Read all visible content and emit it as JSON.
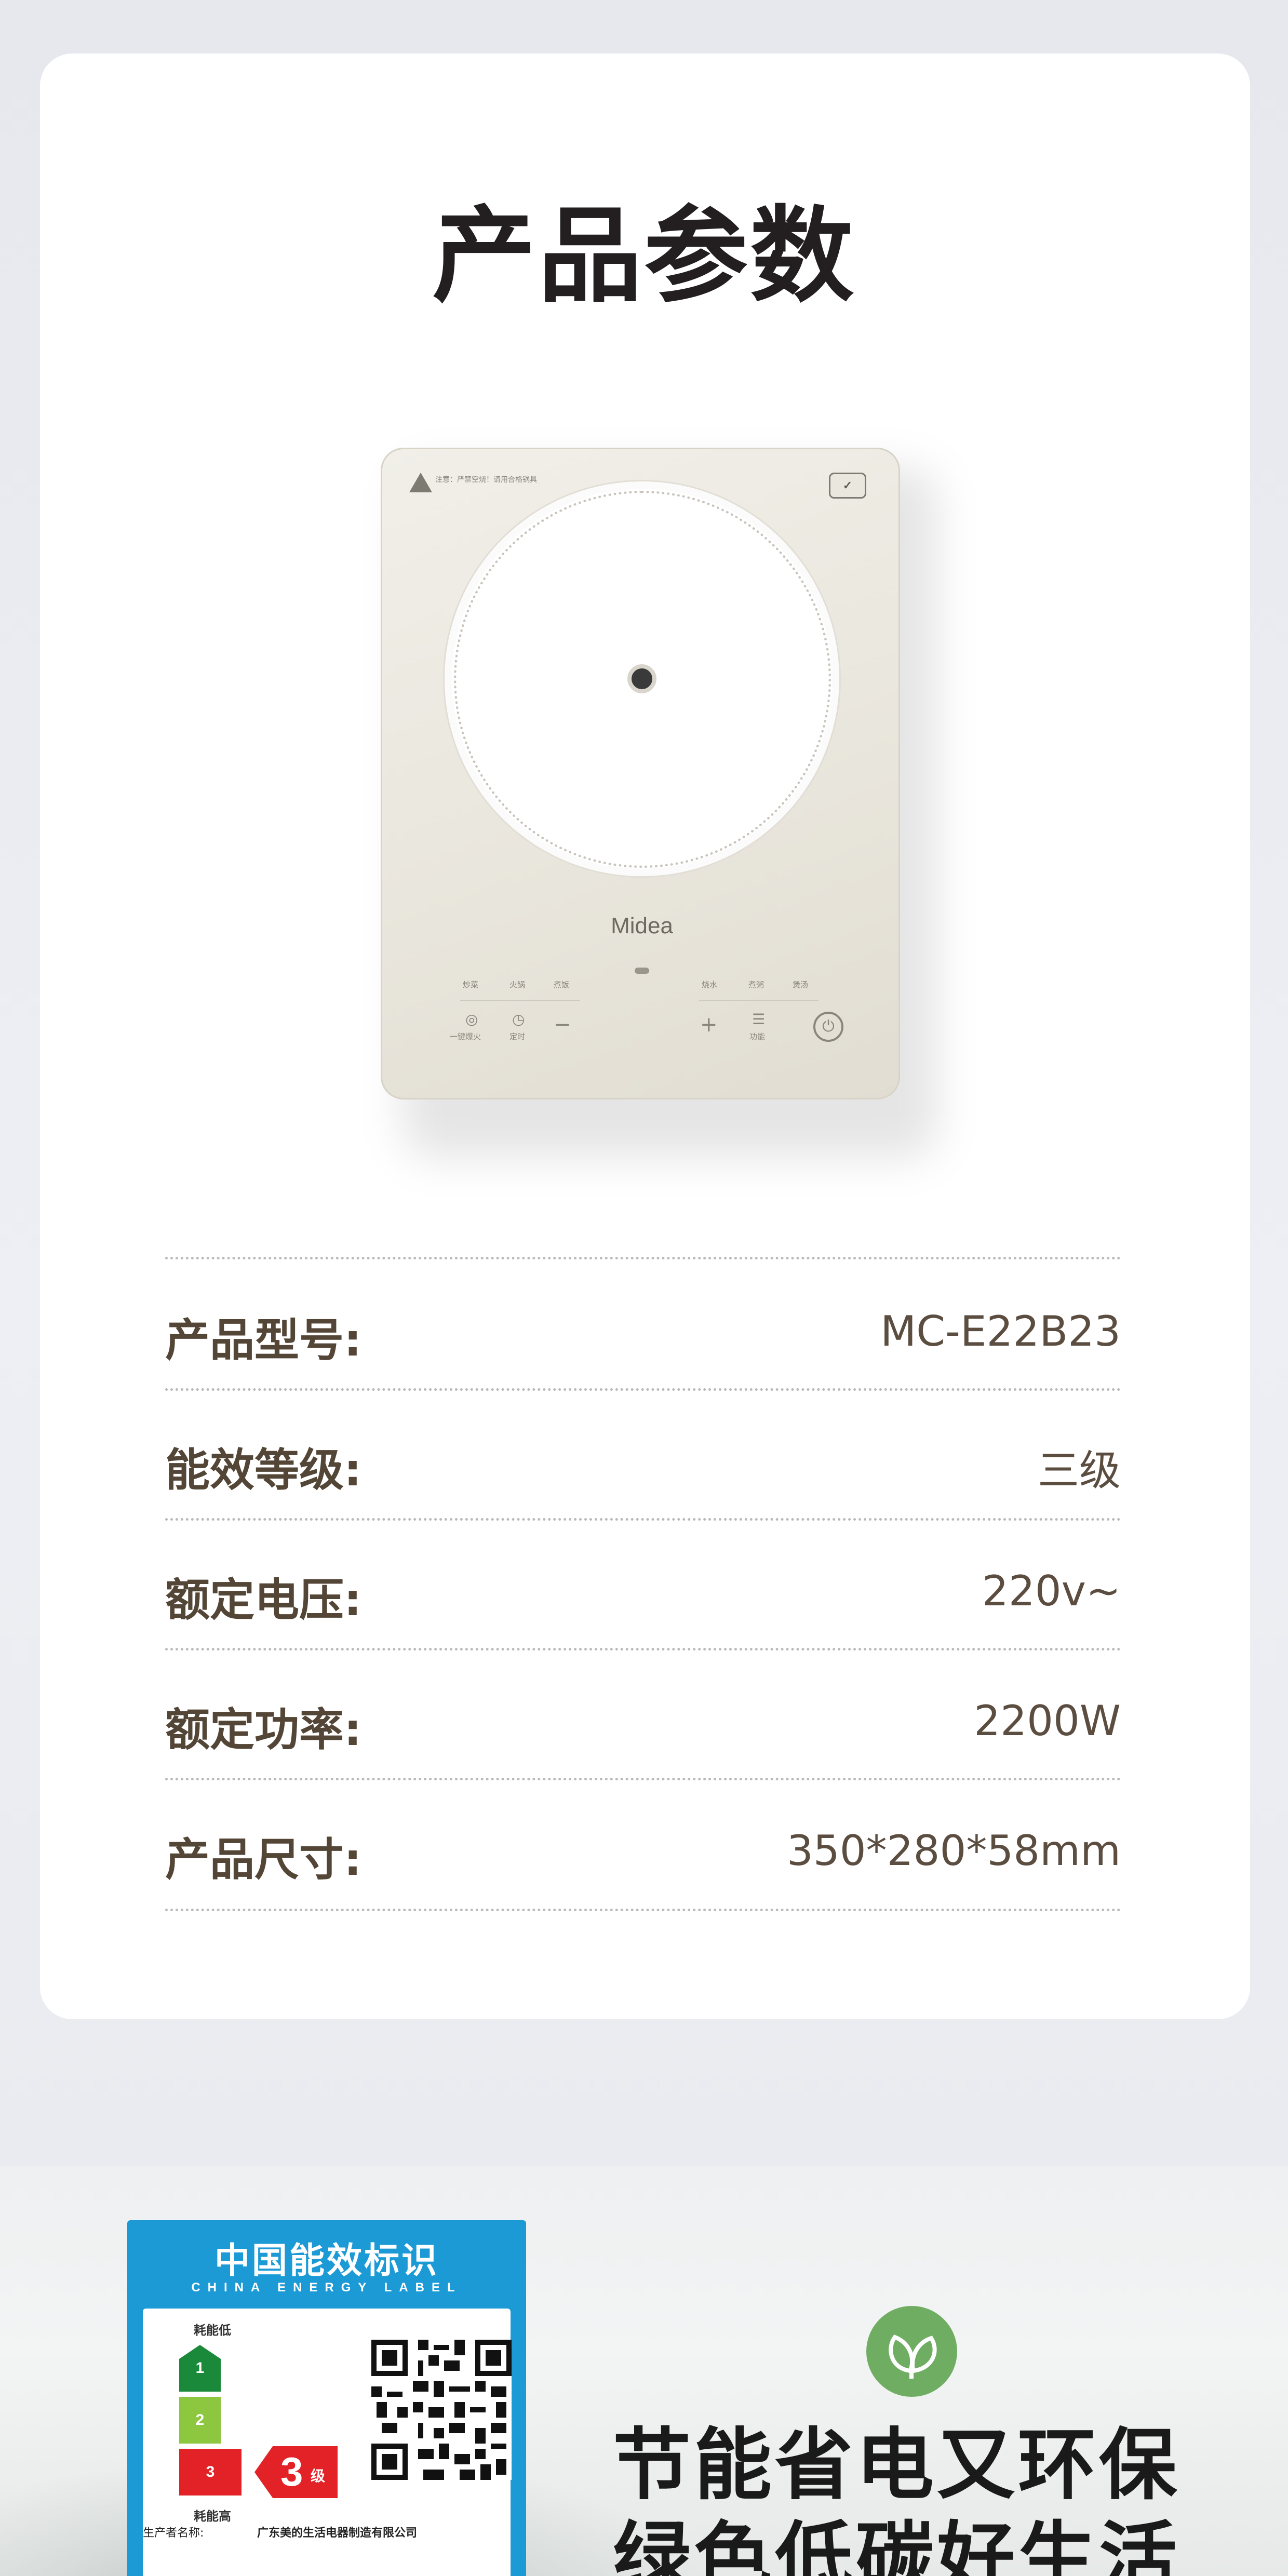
{
  "title": "产品参数",
  "product_image": {
    "logo_text": "Midea",
    "warning_text": "注意：严禁空烧！请用合格锅具",
    "controls_left": [
      "炒菜",
      "火锅",
      "煮饭"
    ],
    "controls_right": [
      "烧水",
      "煮粥",
      "煲汤"
    ],
    "button_labels": [
      "一键爆火",
      "定时",
      "功能"
    ]
  },
  "specs": [
    {
      "label": "产品型号:",
      "value": "MC-E22B23"
    },
    {
      "label": "能效等级:",
      "value": "三级"
    },
    {
      "label": "额定电压:",
      "value": "220v~"
    },
    {
      "label": "额定功率:",
      "value": "2200W"
    },
    {
      "label": "产品尺寸:",
      "value": "350*280*58mm"
    }
  ],
  "energy_label": {
    "title": "中国能效标识",
    "subtitle": "CHINA ENERGY LABEL",
    "low_text": "耗能低",
    "high_text": "耗能高",
    "grades": [
      "1",
      "2",
      "3"
    ],
    "current_grade": "3",
    "grade_suffix": "级",
    "maker_label": "生产者名称:",
    "maker_value": "广东美的生活电器制造有限公司"
  },
  "slogan": {
    "line1": "节能省电又环保",
    "line2": "绿色低碳好生活"
  },
  "colors": {
    "label_text": "#544637",
    "energy_blue": "#1c9ad6",
    "grade_green": "#1a8a3a",
    "grade_lime": "#8dc63f",
    "grade_red": "#e32227",
    "leaf_green": "#6fae62"
  }
}
